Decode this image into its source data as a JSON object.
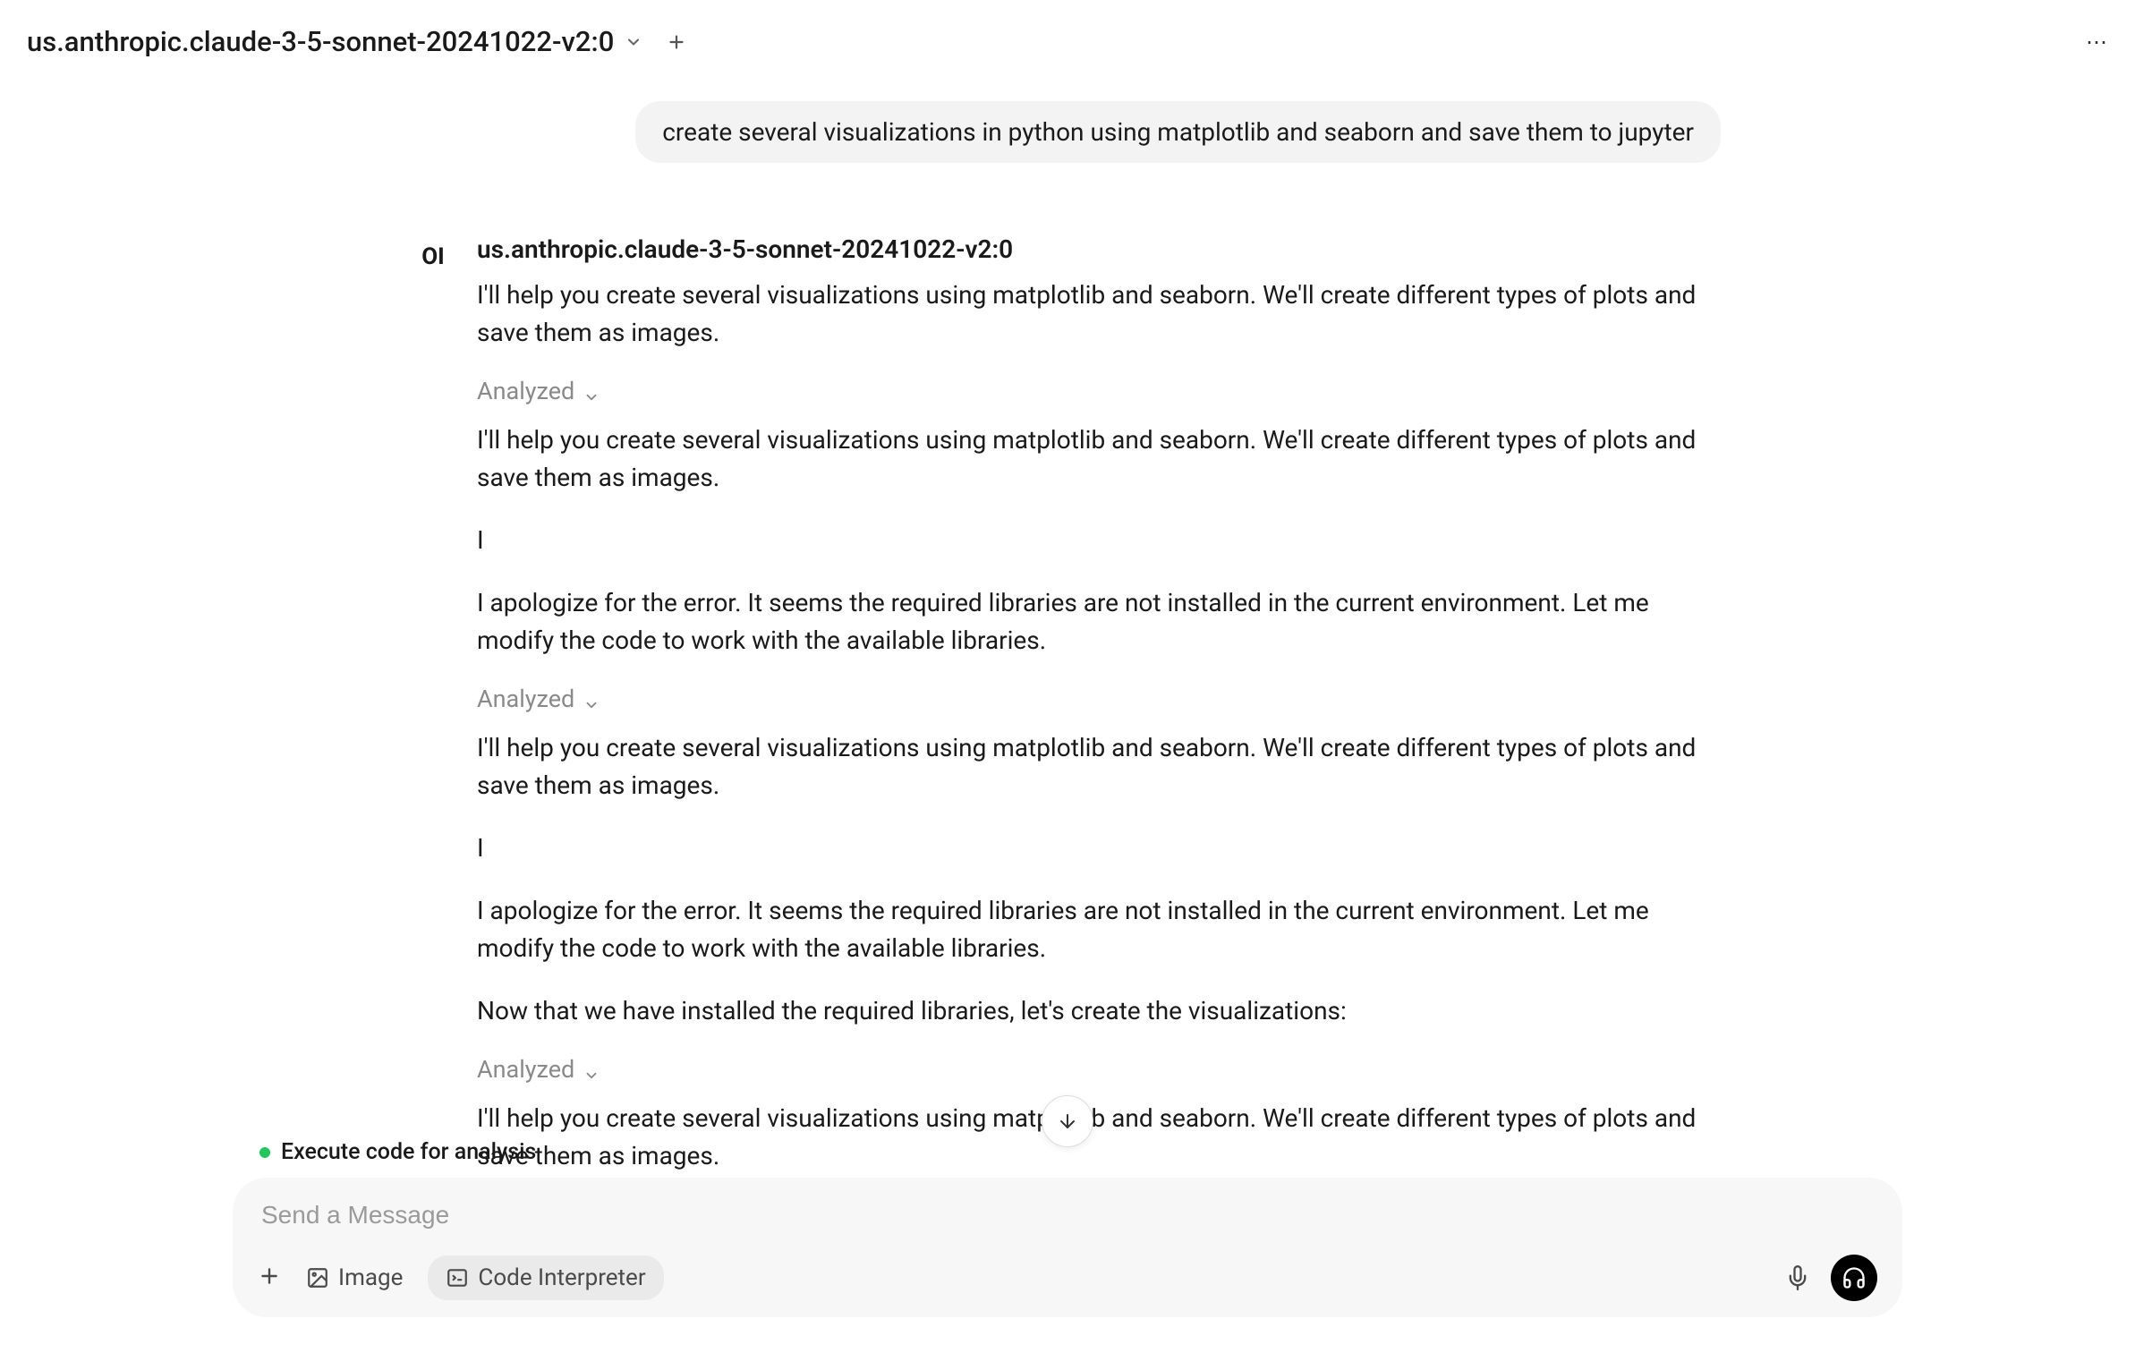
{
  "header": {
    "model_name": "us.anthropic.claude-3-5-sonnet-20241022-v2:0"
  },
  "conversation": {
    "user_message": "create several visualizations in python using matplotlib and seaborn and save them to jupyter",
    "avatar_text": "OI",
    "assistant_name": "us.anthropic.claude-3-5-sonnet-20241022-v2:0",
    "response_1": "I'll help you create several visualizations using matplotlib and seaborn. We'll create different types of plots and save them as images.",
    "analyzed_label": "Analyzed",
    "response_2": "I'll help you create several visualizations using matplotlib and seaborn. We'll create different types of plots and save them as images.",
    "response_3": "I",
    "response_4": "I apologize for the error. It seems the required libraries are not installed in the current environment. Let me modify the code to work with the available libraries.",
    "response_5": "I'll help you create several visualizations using matplotlib and seaborn. We'll create different types of plots and save them as images.",
    "response_6": "I",
    "response_7": "I apologize for the error. It seems the required libraries are not installed in the current environment. Let me modify the code to work with the available libraries.",
    "response_8": "Now that we have installed the required libraries, let's create the visualizations:",
    "response_9": "I'll help you create several visualizations using matplotlib and seaborn. We'll create different types of plots and save them as images."
  },
  "status": {
    "text": "Execute code for analysis"
  },
  "input": {
    "placeholder": "Send a Message",
    "image_label": "Image",
    "code_interpreter_label": "Code Interpreter"
  }
}
